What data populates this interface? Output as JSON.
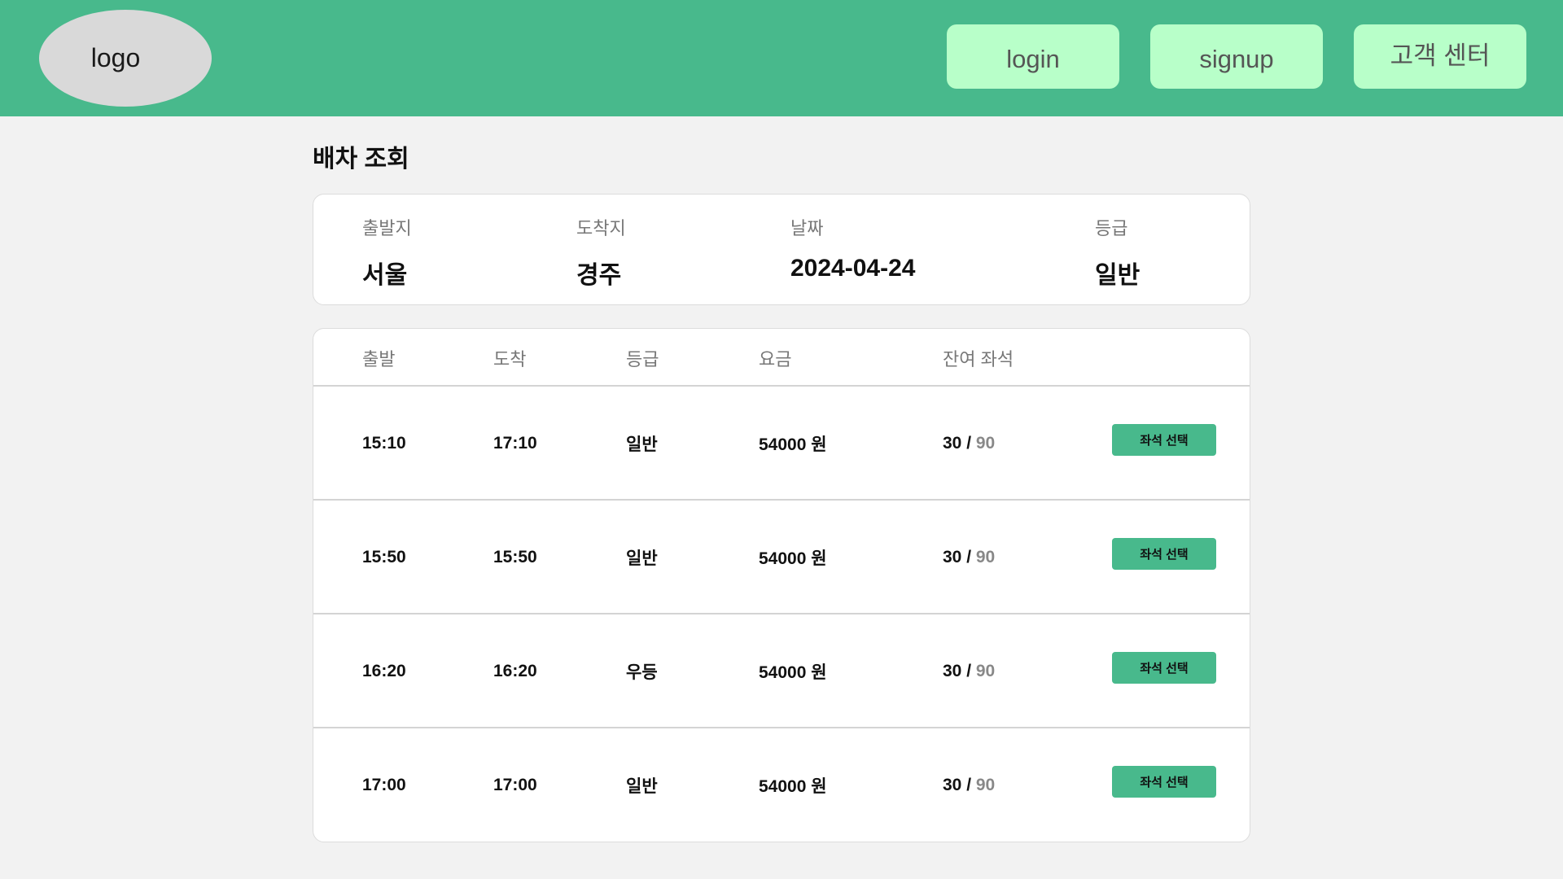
{
  "header": {
    "logo_text": "logo",
    "login_label": "login",
    "signup_label": "signup",
    "support_label": "고객 센터",
    "background": "#48b98c",
    "button_color": "#b8ffc9"
  },
  "page": {
    "title": "배차 조회"
  },
  "summary": {
    "origin_label": "출발지",
    "origin_value": "서울",
    "destination_label": "도착지",
    "destination_value": "경주",
    "date_label": "날짜",
    "date_value": "2024-04-24",
    "grade_label": "등급",
    "grade_value": "일반"
  },
  "table": {
    "headers": {
      "departure": "출발",
      "arrival": "도착",
      "grade": "등급",
      "fare": "요금",
      "seats": "잔여 좌석"
    },
    "seat_button_label": "좌석 선택",
    "rows": [
      {
        "departure": "15:10",
        "arrival": "17:10",
        "grade": "일반",
        "fare": "54000 원",
        "seats_left": "30",
        "seats_sep": " / ",
        "seats_total": "90"
      },
      {
        "departure": "15:50",
        "arrival": "15:50",
        "grade": "일반",
        "fare": "54000 원",
        "seats_left": "30",
        "seats_sep": " / ",
        "seats_total": "90"
      },
      {
        "departure": "16:20",
        "arrival": "16:20",
        "grade": "우등",
        "fare": "54000 원",
        "seats_left": "30",
        "seats_sep": " / ",
        "seats_total": "90"
      },
      {
        "departure": "17:00",
        "arrival": "17:00",
        "grade": "일반",
        "fare": "54000 원",
        "seats_left": "30",
        "seats_sep": " / ",
        "seats_total": "90"
      }
    ]
  }
}
